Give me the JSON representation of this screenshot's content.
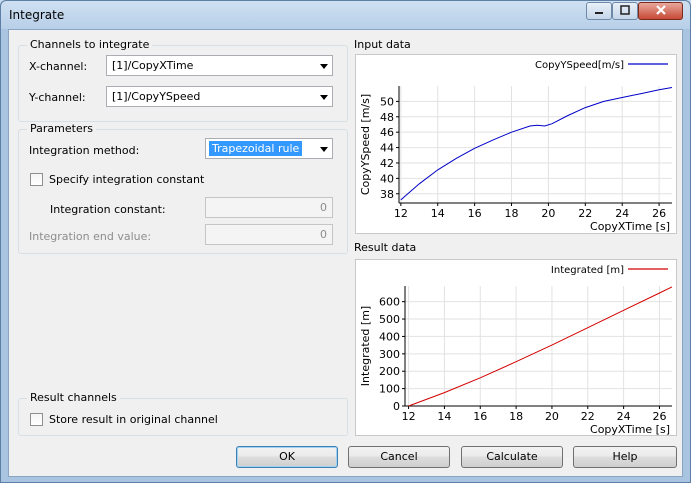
{
  "window": {
    "title": "Integrate"
  },
  "channels": {
    "group_title": "Channels to integrate",
    "x_label": "X-channel:",
    "x_value": "[1]/CopyXTime",
    "y_label": "Y-channel:",
    "y_value": "[1]/CopyYSpeed"
  },
  "parameters": {
    "group_title": "Parameters",
    "method_label": "Integration method:",
    "method_value": "Trapezoidal rule",
    "specify_label": "Specify integration constant",
    "constant_label": "Integration constant:",
    "constant_value": "0",
    "end_label": "Integration end value:",
    "end_value": "0"
  },
  "result_channels": {
    "group_title": "Result channels",
    "store_label": "Store result in original channel"
  },
  "buttons": {
    "ok": "OK",
    "cancel": "Cancel",
    "calculate": "Calculate",
    "help": "Help"
  },
  "input_plot": {
    "section_title": "Input data"
  },
  "result_plot": {
    "section_title": "Result data"
  },
  "chart_data": [
    {
      "type": "line",
      "legend": "CopyYSpeed[m/s]",
      "xlabel": "CopyXTime [s]",
      "ylabel": "CopyYSpeed [m/s]",
      "xlim": [
        11.9,
        26.7
      ],
      "ylim": [
        36.8,
        52
      ],
      "xticks": [
        12,
        14,
        16,
        18,
        20,
        22,
        24,
        26
      ],
      "yticks": [
        38,
        40,
        42,
        44,
        46,
        48,
        50
      ],
      "color": "#0000c8",
      "series": [
        {
          "name": "CopyYSpeed[m/s]",
          "x": [
            12,
            13,
            14,
            15,
            16,
            17,
            18,
            19,
            19.4,
            19.8,
            20.2,
            21,
            22,
            23,
            24,
            25,
            26,
            26.7
          ],
          "y": [
            37.2,
            39.3,
            41.1,
            42.6,
            43.9,
            45.0,
            46.0,
            46.8,
            46.9,
            46.8,
            47.1,
            48.1,
            49.2,
            50.0,
            50.5,
            51.0,
            51.5,
            51.8
          ]
        }
      ]
    },
    {
      "type": "line",
      "legend": "Integrated [m]",
      "xlabel": "CopyXTime [s]",
      "ylabel": "Integrated [m]",
      "xlim": [
        11.8,
        26.7
      ],
      "ylim": [
        0,
        690
      ],
      "xticks": [
        12,
        14,
        16,
        18,
        20,
        22,
        24,
        26
      ],
      "yticks": [
        0,
        100,
        200,
        300,
        400,
        500,
        600
      ],
      "color": "#d40000",
      "series": [
        {
          "name": "Integrated [m]",
          "x": [
            12,
            14,
            16,
            18,
            20,
            22,
            24,
            26,
            26.7
          ],
          "y": [
            0,
            77,
            162,
            255,
            350,
            450,
            550,
            650,
            685
          ]
        }
      ]
    }
  ]
}
